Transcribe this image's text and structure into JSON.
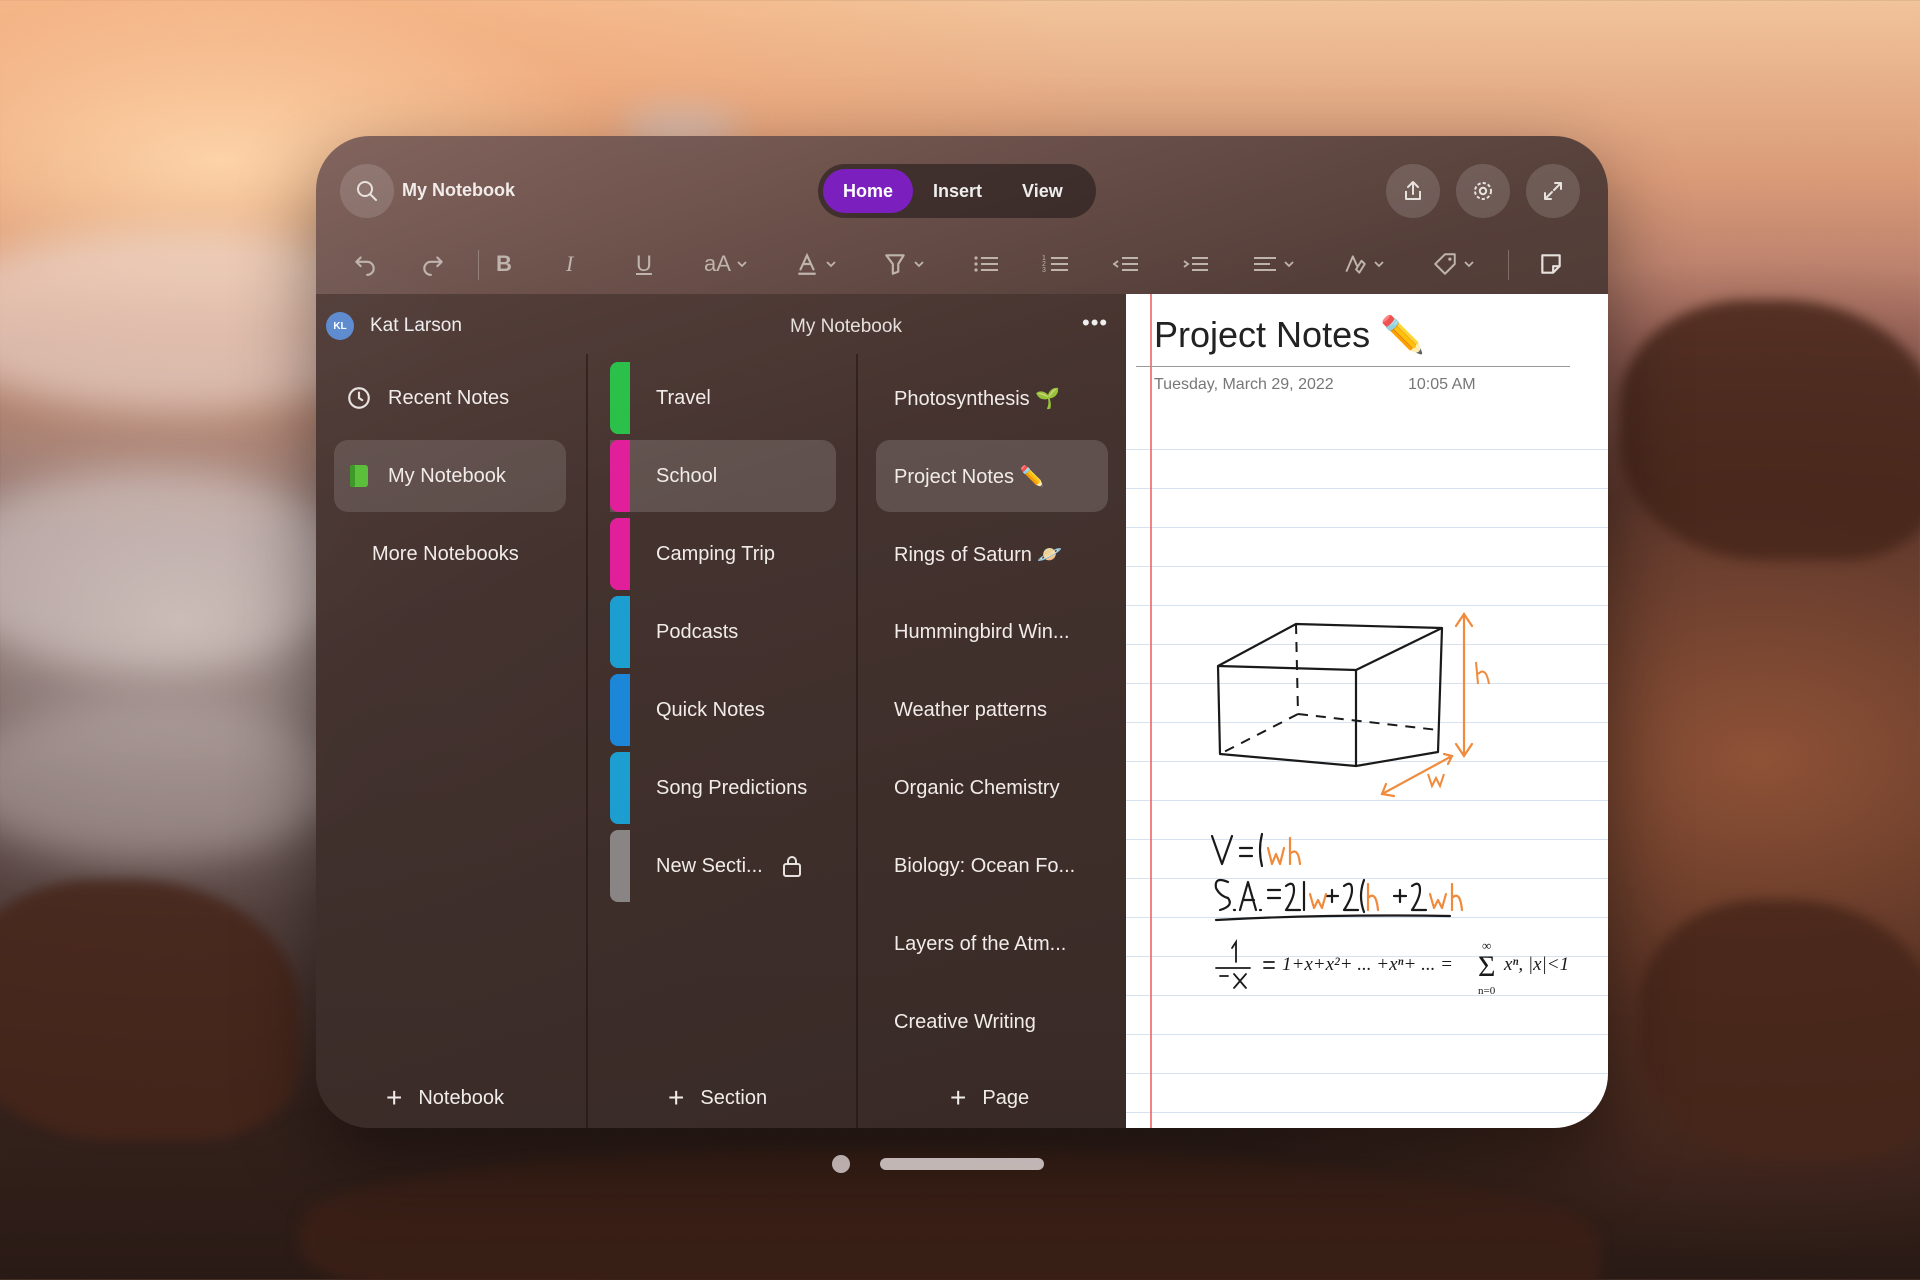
{
  "window": {
    "notebook_title": "My Notebook"
  },
  "tabs": [
    {
      "label": "Home",
      "active": true
    },
    {
      "label": "Insert",
      "active": false
    },
    {
      "label": "View",
      "active": false
    }
  ],
  "toolbar": {
    "bold": "B",
    "italic": "I",
    "underline": "U",
    "font_size": "aA",
    "accent_color": "#7b1fbf"
  },
  "account": {
    "initials": "KL",
    "name": "Kat Larson",
    "notebook_header": "My Notebook",
    "more": "•••"
  },
  "notebooks": {
    "items": [
      {
        "label": "Recent Notes",
        "icon": "clock-icon"
      },
      {
        "label": "My Notebook",
        "icon": "notebook-icon",
        "selected": true
      },
      {
        "label": "More Notebooks"
      }
    ],
    "add_label": "Notebook"
  },
  "sections": {
    "items": [
      {
        "label": "Travel",
        "color": "#2bc04a"
      },
      {
        "label": "School",
        "color": "#e21f9a",
        "selected": true
      },
      {
        "label": "Camping Trip",
        "color": "#e21f9a"
      },
      {
        "label": "Podcasts",
        "color": "#1c9fd0"
      },
      {
        "label": "Quick Notes",
        "color": "#1c86d8"
      },
      {
        "label": "Song Predictions",
        "color": "#1c9fd0"
      },
      {
        "label": "New Secti...",
        "color": "#8a8585",
        "locked": true
      }
    ],
    "add_label": "Section"
  },
  "pages": {
    "items": [
      {
        "label": "Photosynthesis 🌱"
      },
      {
        "label": "Project Notes ✏️",
        "selected": true
      },
      {
        "label": "Rings of Saturn 🪐"
      },
      {
        "label": "Hummingbird Win..."
      },
      {
        "label": "Weather patterns"
      },
      {
        "label": "Organic Chemistry"
      },
      {
        "label": "Biology: Ocean Fo..."
      },
      {
        "label": "Layers of the Atm..."
      },
      {
        "label": "Creative Writing"
      }
    ],
    "add_label": "Page"
  },
  "note": {
    "title": "Project Notes ✏️",
    "date": "Tuesday, March 29, 2022",
    "time": "10:05 AM"
  }
}
